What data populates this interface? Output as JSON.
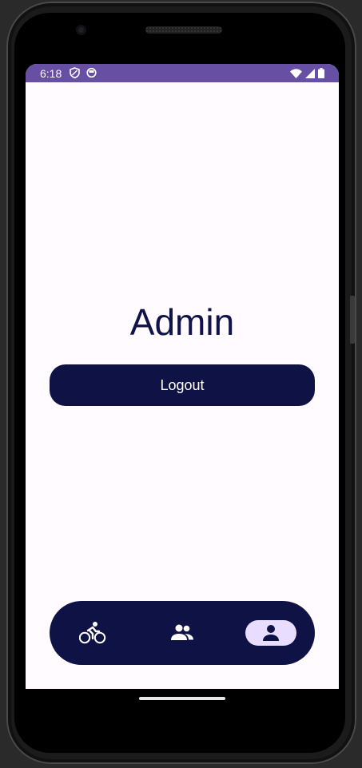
{
  "status_bar": {
    "time": "6:18",
    "left_icons": [
      "shield-icon",
      "sim-icon"
    ],
    "right_icons": [
      "wifi-icon",
      "signal-icon",
      "battery-icon"
    ],
    "color": "#6750a4"
  },
  "main": {
    "title": "Admin",
    "logout_label": "Logout"
  },
  "bottom_nav": {
    "items": [
      {
        "icon": "bike-icon",
        "selected": false
      },
      {
        "icon": "people-icon",
        "selected": false
      },
      {
        "icon": "person-icon",
        "selected": true
      }
    ]
  },
  "colors": {
    "primary_dark": "#0e1245",
    "selected_indicator": "#e8ddff",
    "background": "#fffbfe"
  }
}
